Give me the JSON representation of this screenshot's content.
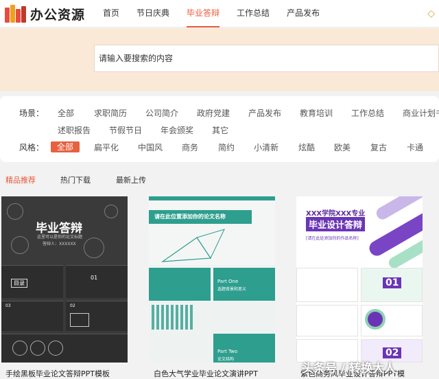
{
  "header": {
    "logo_text": "办公资源",
    "nav": [
      "首页",
      "节日庆典",
      "毕业答辩",
      "工作总结",
      "产品发布"
    ],
    "active_nav": "毕业答辩",
    "vip_icon": "diamond-icon"
  },
  "search": {
    "placeholder": "请输入要搜索的内容"
  },
  "filters": {
    "scene_label": "场景：",
    "scenes_row1": [
      "全部",
      "求职简历",
      "公司简介",
      "政府党建",
      "产品发布",
      "教育培训",
      "工作总结",
      "商业计划书"
    ],
    "scenes_row2": [
      "述职报告",
      "节假节日",
      "年会颁奖",
      "其它"
    ],
    "style_label": "风格：",
    "styles": [
      "全部",
      "扁平化",
      "中国风",
      "商务",
      "简约",
      "小清新",
      "炫酷",
      "欧美",
      "复古",
      "卡通"
    ],
    "active_style": "全部"
  },
  "tabs": [
    "精品推荐",
    "热门下载",
    "最新上传"
  ],
  "active_tab": "精品推荐",
  "cards": [
    {
      "title": "手绘黑板毕业论文答辩PPT模板",
      "thumb": {
        "main": "毕业答辩",
        "sub": "这里可以是你的论文标题",
        "author": "答辩人：XXXXXX",
        "toc": "目录",
        "n1": "01",
        "n2": "02",
        "n3": "03"
      }
    },
    {
      "title": "白色大气学业毕业论文演讲PPT",
      "thumb": {
        "heading": "请在此位置添加你的论文名称",
        "part1": "Part One",
        "part2": "Part Two",
        "p1sub": "选题背景和意义",
        "p2sub": "论文结构"
      }
    },
    {
      "title": "紫色商务风毕业设计答辩PPT模",
      "thumb": {
        "school": "XXX学院XXX专业",
        "main": "毕业设计答辩",
        "sub": "[请在此处添加你的作品名称]",
        "n1": "01",
        "n2": "02"
      }
    }
  ],
  "watermark": "头条号 / 转换大人"
}
